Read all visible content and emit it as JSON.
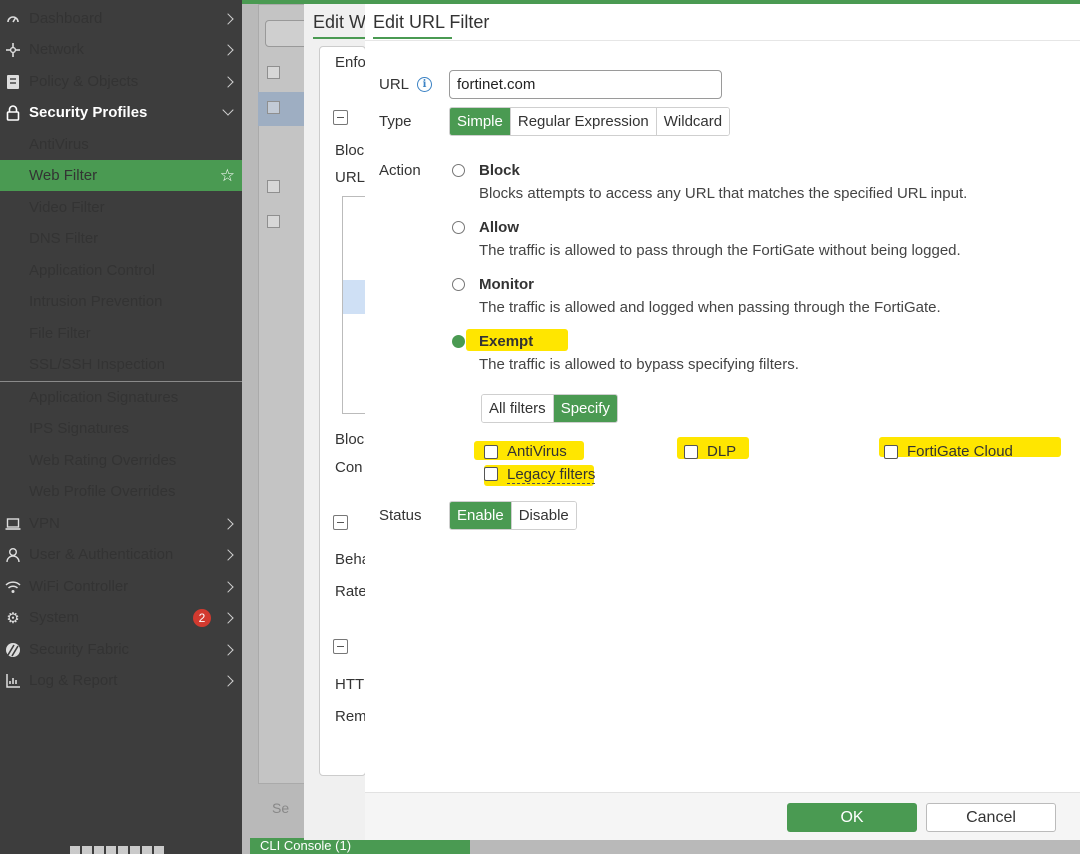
{
  "sidebar": {
    "items": [
      {
        "label": "Dashboard",
        "icon": "dashboard-icon"
      },
      {
        "label": "Network",
        "icon": "network-icon"
      },
      {
        "label": "Policy & Objects",
        "icon": "policy-icon"
      },
      {
        "label": "Security Profiles",
        "icon": "lock-icon"
      },
      {
        "label": "VPN",
        "icon": "vpn-icon"
      },
      {
        "label": "User & Authentication",
        "icon": "user-icon"
      },
      {
        "label": "WiFi Controller",
        "icon": "wifi-icon"
      },
      {
        "label": "System",
        "icon": "gear-icon",
        "badge": "2"
      },
      {
        "label": "Security Fabric",
        "icon": "fabric-icon"
      },
      {
        "label": "Log & Report",
        "icon": "report-icon"
      }
    ],
    "security_sub": [
      "AntiVirus",
      "Web Filter",
      "Video Filter",
      "DNS Filter",
      "Application Control",
      "Intrusion Prevention",
      "File Filter",
      "SSL/SSH Inspection",
      "Application Signatures",
      "IPS Signatures",
      "Web Rating Overrides",
      "Web Profile Overrides"
    ],
    "active": "Web Filter"
  },
  "background": {
    "mid_title": "Edit W",
    "mid_labels": [
      "Enfo",
      "Bloc",
      "URL",
      "Bloc",
      "Con",
      "Beha",
      "Rate",
      "HTT",
      "Rem"
    ],
    "footer_text": "Se",
    "cli_tab": "CLI Console (1)"
  },
  "modal": {
    "title": "Edit URL Filter",
    "url_label": "URL",
    "url_value": "fortinet.com",
    "type_label": "Type",
    "type_options": [
      "Simple",
      "Regular Expression",
      "Wildcard"
    ],
    "type_selected": "Simple",
    "action_label": "Action",
    "actions": [
      {
        "title": "Block",
        "desc": "Blocks attempts to access any URL that matches the specified URL input."
      },
      {
        "title": "Allow",
        "desc": "The traffic is allowed to pass through the FortiGate without being logged."
      },
      {
        "title": "Monitor",
        "desc": "The traffic is allowed and logged when passing through the FortiGate."
      },
      {
        "title": "Exempt",
        "desc": "The traffic is allowed to bypass specifying filters."
      }
    ],
    "action_selected": "Exempt",
    "filter_scope": [
      "All filters",
      "Specify"
    ],
    "filter_scope_selected": "Specify",
    "filters": [
      "AntiVirus",
      "DLP",
      "FortiGate Cloud",
      "Legacy filters"
    ],
    "status_label": "Status",
    "status_options": [
      "Enable",
      "Disable"
    ],
    "status_selected": "Enable",
    "ok_label": "OK",
    "cancel_label": "Cancel"
  },
  "colors": {
    "accent": "#4a9a52",
    "highlight": "#ffe600",
    "badge": "#d23a2f",
    "sidebar": "#3d3d3d"
  }
}
